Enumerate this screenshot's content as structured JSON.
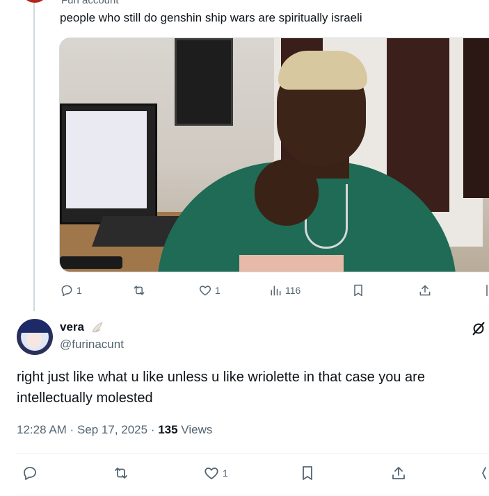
{
  "quoted_tweet": {
    "account_label": "Furi account",
    "text": "people who still do genshin ship wars are spiritually israeli",
    "actions": {
      "replies": "1",
      "reposts": "",
      "likes": "1",
      "views": "116"
    }
  },
  "reply": {
    "display_name": "vera",
    "handle": "@furinacunt",
    "text": "right just like what u like unless u like wriolette in that case you are intellectually molested",
    "time": "12:28 AM",
    "separator": " · ",
    "date": "Sep 17, 2025",
    "views_count": "135",
    "views_label": " Views",
    "actions": {
      "likes": "1"
    }
  },
  "colors": {
    "text_primary": "#0f1419",
    "text_secondary": "#536471",
    "thread_line": "#cfd9de",
    "divider": "#eff3f4"
  },
  "icons": [
    "reply-icon",
    "repost-icon",
    "like-icon",
    "views-icon",
    "bookmark-icon",
    "share-icon",
    "grok-icon",
    "angel-wing-emoji"
  ]
}
